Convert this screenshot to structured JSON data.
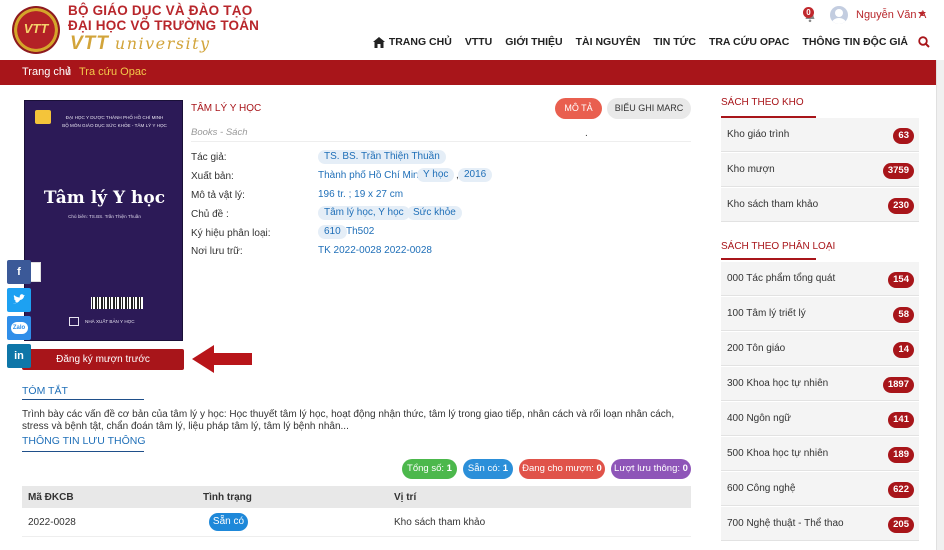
{
  "header": {
    "brand_line1": "BỘ GIÁO DỤC VÀ ĐÀO TẠO",
    "brand_line2": "ĐẠI HỌC VÕ TRƯỜNG TOẢN",
    "brand_vtt": "VTT",
    "brand_university": "university",
    "logo_text": "VTT",
    "notification_count": "0",
    "user_name": "Nguyễn Văn A",
    "nav": [
      "TRANG CHỦ",
      "VTTU",
      "GIỚI THIỆU",
      "TÀI NGUYÊN",
      "TIN TỨC",
      "TRA CỨU OPAC",
      "THÔNG TIN ĐỘC GIẢ"
    ]
  },
  "breadcrumb": {
    "home": "Trang chủ",
    "separator": "/",
    "current": "Tra cứu Opac"
  },
  "cover": {
    "top1": "ĐẠI HỌC Y DƯỢC THÀNH PHỐ HỒ CHÍ MINH",
    "top2": "BỘ MÔN GIÁO DỤC SỨC KHỎE - TÂM LÝ Y HỌC",
    "title": "Tâm lý Y học",
    "subtitle": "Chủ biên: TS.BS. Trần Thiện Thuần",
    "publisher": "NHÀ XUẤT BẢN Y HỌC"
  },
  "borrow_button": "Đăng ký mượn trước",
  "book": {
    "title": "TÂM LÝ Y HỌC",
    "type": "Books - Sách",
    "dot": ".",
    "tab_description": "MÔ TẢ",
    "tab_marc": "BIỂU GHI MARC",
    "labels": {
      "author": "Tác giả:",
      "publish": "Xuất bản:",
      "physical": "Mô tả vật lý:",
      "subject": "Chủ đề :",
      "classification": "Ký hiệu phân loại:",
      "location": "Nơi lưu trữ:"
    },
    "author": "TS. BS. Trần Thiện Thuần",
    "publish_place": "Thành phố Hồ Chí Minh :",
    "publisher": "Y học",
    "publish_sep": ",",
    "year": "2016",
    "physical": "196 tr. ; 19 x 27 cm",
    "subject1": "Tâm lý học, Y học",
    "subject2": "Sức khỏe",
    "class_code": "610",
    "class_cutter": "Th502",
    "location": "TK 2022-0028 2022-0028"
  },
  "summary": {
    "title": "TÓM TẮT",
    "text": "Trình bày các vấn đề cơ bản của tâm lý y học: Học thuyết tâm lý học, hoạt động nhận thức, tâm lý trong giao tiếp, nhân cách và rối loạn nhân cách, stress và bệnh tật, chẩn đoán tâm lý, liệu pháp tâm lý, tâm lý bệnh nhân..."
  },
  "circulation": {
    "title": "THÔNG TIN LƯU THÔNG",
    "stats": [
      {
        "label": "Tổng số:",
        "value": "1",
        "color": "#4cb84c"
      },
      {
        "label": "Sẵn có:",
        "value": "1",
        "color": "#2b8fd9"
      },
      {
        "label": "Đang cho mượn:",
        "value": "0",
        "color": "#e0534a"
      },
      {
        "label": "Lượt lưu thông:",
        "value": "0",
        "color": "#8e55b8"
      }
    ],
    "columns": [
      "Mã ĐKCB",
      "Tình trạng",
      "Vị trí"
    ],
    "rows": [
      {
        "code": "2022-0028",
        "status": "Sẵn có",
        "location": "Kho sách tham khảo"
      }
    ]
  },
  "sidebar": {
    "by_store_title": "SÁCH THEO KHO",
    "stores": [
      {
        "label": "Kho giáo trình",
        "count": "63"
      },
      {
        "label": "Kho mượn",
        "count": "3759"
      },
      {
        "label": "Kho sách tham khảo",
        "count": "230"
      }
    ],
    "by_class_title": "SÁCH THEO PHÂN LOẠI",
    "classes": [
      {
        "label": "000 Tác phẩm tổng quát",
        "count": "154"
      },
      {
        "label": "100 Tâm lý triết lý",
        "count": "58"
      },
      {
        "label": "200 Tôn giáo",
        "count": "14"
      },
      {
        "label": "300 Khoa học tự nhiên",
        "count": "1897"
      },
      {
        "label": "400 Ngôn ngữ",
        "count": "141"
      },
      {
        "label": "500 Khoa học tự nhiên",
        "count": "189"
      },
      {
        "label": "600 Công nghệ",
        "count": "622"
      },
      {
        "label": "700 Nghệ thuật - Thể thao",
        "count": "205"
      }
    ]
  },
  "social": {
    "facebook": "f",
    "twitter": "t",
    "zalo": "Zalo",
    "linkedin": "in"
  },
  "colors": {
    "brand_red": "#a8151a",
    "link_blue": "#1f6fb8",
    "gold": "#d2a43a"
  }
}
